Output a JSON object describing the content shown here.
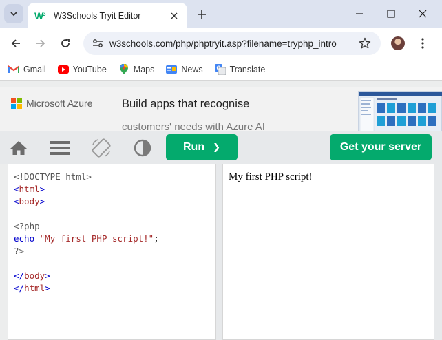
{
  "browser": {
    "tab_title": "W3Schools Tryit Editor",
    "url": "w3schools.com/php/phptryit.asp?filename=tryphp_intro"
  },
  "bookmarks": [
    {
      "label": "Gmail",
      "icon": "gmail-icon"
    },
    {
      "label": "YouTube",
      "icon": "youtube-icon"
    },
    {
      "label": "Maps",
      "icon": "maps-icon"
    },
    {
      "label": "News",
      "icon": "news-icon"
    },
    {
      "label": "Translate",
      "icon": "translate-icon"
    }
  ],
  "ad": {
    "brand": "Microsoft Azure",
    "headline": "Build apps that recognise",
    "subline": "customers' needs with Azure AI"
  },
  "toolbar": {
    "run_label": "Run",
    "run_chevron": "❯",
    "server_label": "Get your server"
  },
  "editor": {
    "lines": [
      "<!DOCTYPE html>",
      "<html>",
      "<body>",
      "",
      "<?php",
      "echo \"My first PHP script!\";",
      "?>",
      "",
      "</body>",
      "</html>"
    ]
  },
  "output": {
    "text": "My first PHP script!"
  },
  "colors": {
    "accent_green": "#04aa6d",
    "chrome_bg": "#dde3f0",
    "toolbar_bg": "#e7e9eb"
  }
}
